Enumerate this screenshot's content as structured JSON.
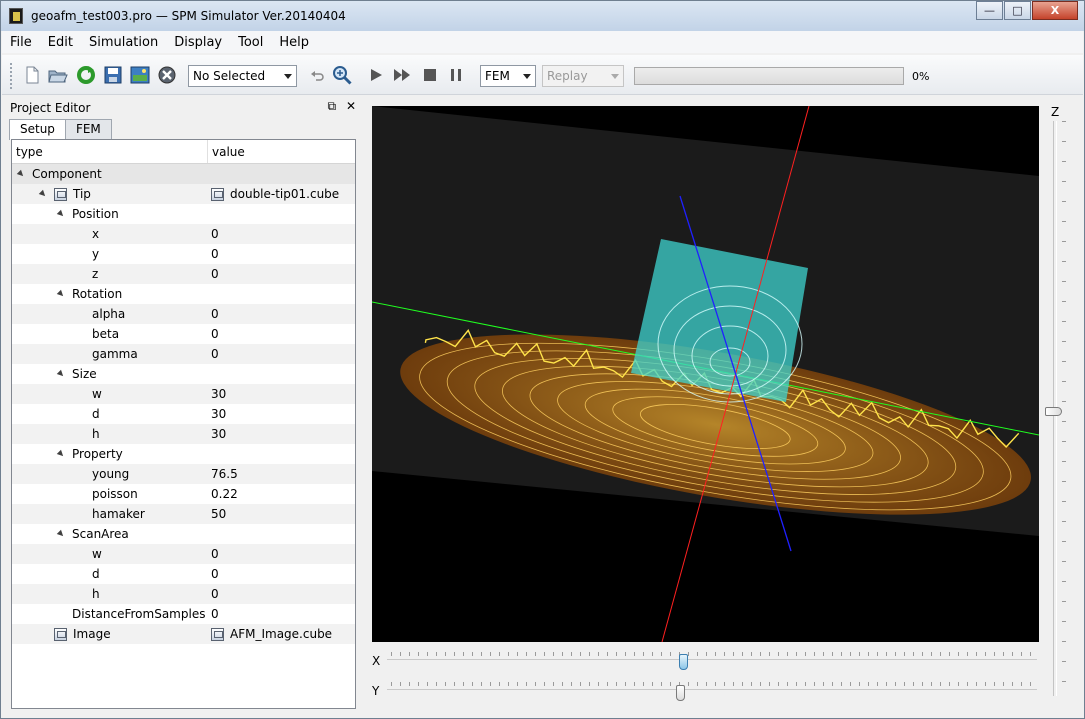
{
  "window": {
    "title": "geoafm_test003.pro — SPM Simulator Ver.20140404",
    "min_glyph": "—",
    "max_glyph": "□",
    "close_glyph": "X"
  },
  "menu": [
    "File",
    "Edit",
    "Simulation",
    "Display",
    "Tool",
    "Help"
  ],
  "toolbar": {
    "selection_combo": "No Selected",
    "mode_combo": "FEM",
    "replay_combo": "Replay",
    "progress_value": 0,
    "progress_text": "0%"
  },
  "panel": {
    "title": "Project Editor",
    "float_glyph": "⧉",
    "close_glyph": "✕",
    "tabs": [
      "Setup",
      "FEM"
    ],
    "columns": [
      "type",
      "value"
    ],
    "rows": [
      {
        "label": "Component",
        "value": ""
      },
      {
        "label": "Tip",
        "value": "double-tip01.cube"
      },
      {
        "label": "Position",
        "value": ""
      },
      {
        "label": "x",
        "value": "0"
      },
      {
        "label": "y",
        "value": "0"
      },
      {
        "label": "z",
        "value": "0"
      },
      {
        "label": "Rotation",
        "value": ""
      },
      {
        "label": "alpha",
        "value": "0"
      },
      {
        "label": "beta",
        "value": "0"
      },
      {
        "label": "gamma",
        "value": "0"
      },
      {
        "label": "Size",
        "value": ""
      },
      {
        "label": "w",
        "value": "30"
      },
      {
        "label": "d",
        "value": "30"
      },
      {
        "label": "h",
        "value": "30"
      },
      {
        "label": "Property",
        "value": ""
      },
      {
        "label": "young",
        "value": "76.5"
      },
      {
        "label": "poisson",
        "value": "0.22"
      },
      {
        "label": "hamaker",
        "value": "50"
      },
      {
        "label": "ScanArea",
        "value": ""
      },
      {
        "label": "w",
        "value": "0"
      },
      {
        "label": "d",
        "value": "0"
      },
      {
        "label": "h",
        "value": "0"
      },
      {
        "label": "DistanceFromSamples",
        "value": "0"
      },
      {
        "label": "Image",
        "value": "AFM_Image.cube"
      }
    ]
  },
  "view": {
    "x_label": "X",
    "y_label": "Y",
    "z_label": "Z",
    "x_slider_value": 0.5,
    "y_slider_value": 0.5,
    "z_slider_value": 0.5,
    "colors": {
      "sample": "#f0a020",
      "sample_edge": "#ffd84a",
      "probe": "#5de2e0",
      "axis_x": "#ff2020",
      "axis_y": "#20ff20",
      "axis_z": "#2020ff",
      "plane": "#1a1a1a"
    }
  }
}
